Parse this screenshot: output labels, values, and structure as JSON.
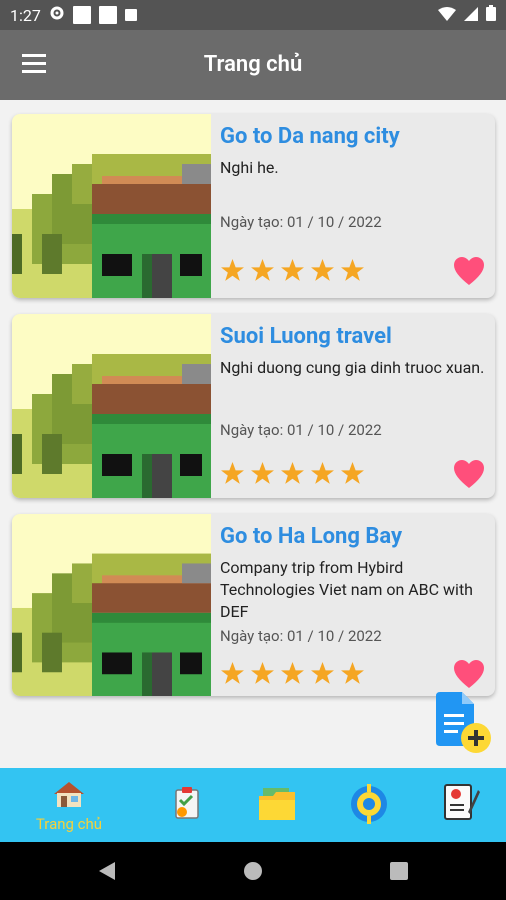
{
  "status_bar": {
    "time": "1:27"
  },
  "app_bar": {
    "title": "Trang chủ"
  },
  "trips": [
    {
      "title": "Go to Da nang city",
      "description": "Nghi he.",
      "date": "Ngày tạo: 01 / 10 / 2022",
      "rating": 5,
      "favorite": true
    },
    {
      "title": "Suoi Luong travel",
      "description": "Nghi duong cung gia dinh truoc xuan.",
      "date": "Ngày tạo: 01 / 10 / 2022",
      "rating": 5,
      "favorite": true
    },
    {
      "title": "Go to Ha Long Bay",
      "description": "Company trip from Hybird Technologies Viet nam on ABC with DEF",
      "date": "Ngày tạo: 01 / 10 / 2022",
      "rating": 5,
      "favorite": true
    }
  ],
  "bottom_nav": {
    "items": [
      {
        "label": "Trang chủ",
        "icon": "home-icon",
        "active": true
      },
      {
        "label": "",
        "icon": "plan-icon",
        "active": false
      },
      {
        "label": "",
        "icon": "folder-icon",
        "active": false
      },
      {
        "label": "",
        "icon": "settings-icon",
        "active": false
      },
      {
        "label": "",
        "icon": "edit-note-icon",
        "active": false
      }
    ]
  },
  "colors": {
    "accent_title": "#2e8de0",
    "star": "#f5a623",
    "heart": "#ff4f7b",
    "nav_bg": "#33c4f2",
    "nav_active": "#f6d13a",
    "app_bar": "#6b6b6b"
  }
}
